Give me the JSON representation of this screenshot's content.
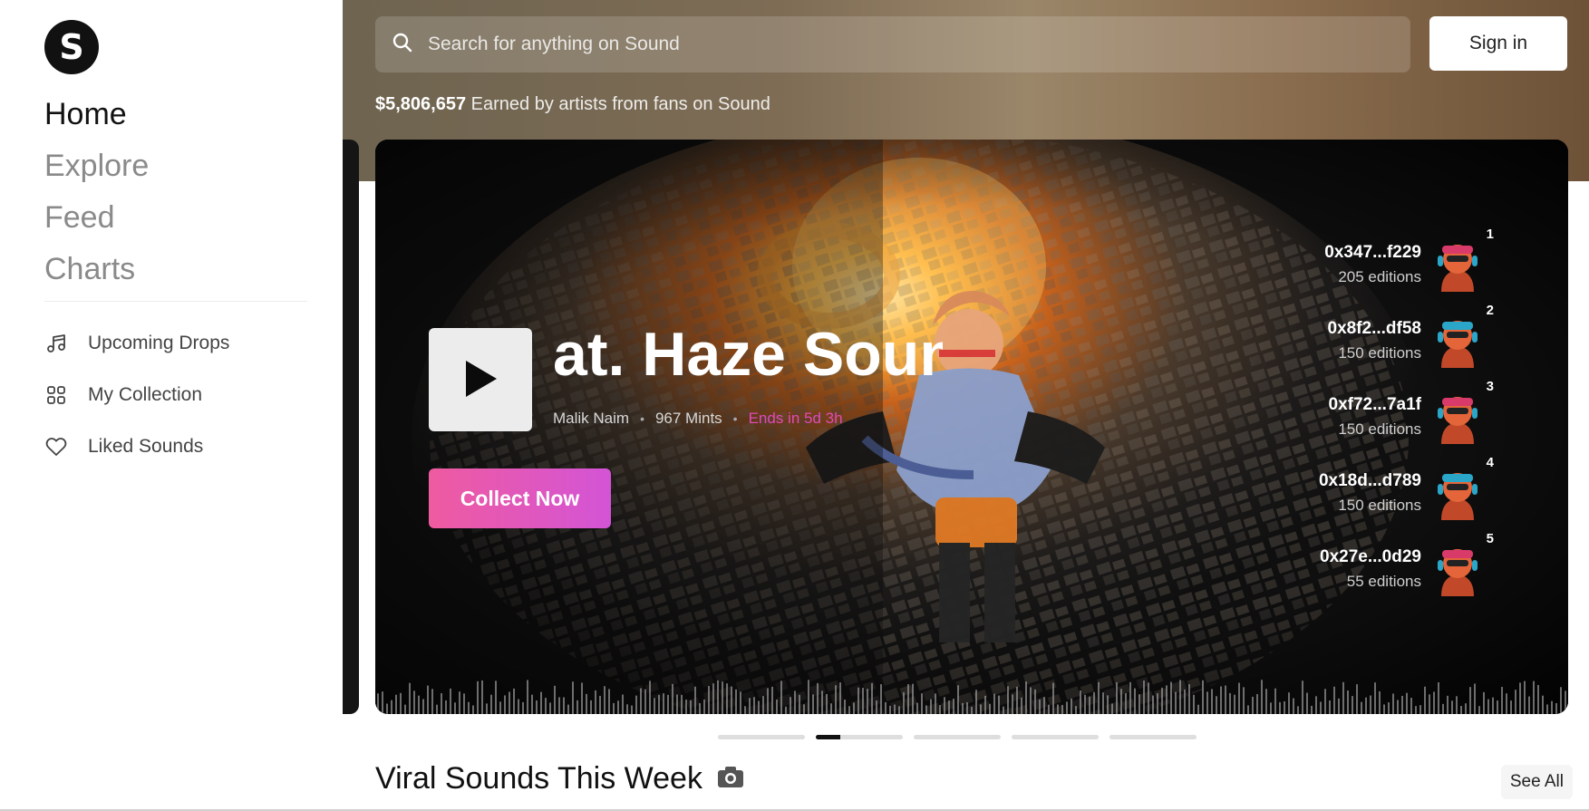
{
  "sidebar": {
    "logo_letter": "S",
    "nav": [
      {
        "label": "Home"
      },
      {
        "label": "Explore"
      },
      {
        "label": "Feed"
      },
      {
        "label": "Charts"
      }
    ],
    "sub_nav": [
      {
        "label": "Upcoming Drops",
        "icon": "music-note-icon"
      },
      {
        "label": "My Collection",
        "icon": "grid-icon"
      },
      {
        "label": "Liked Sounds",
        "icon": "heart-icon"
      }
    ]
  },
  "header": {
    "search_placeholder": "Search for anything on Sound",
    "signin_label": "Sign in",
    "earned_amount": "$5,806,657",
    "earned_text": "Earned by artists from fans on Sound"
  },
  "hero": {
    "title": "at. Haze  Sound",
    "artist": "Malik Naim",
    "mints": "967 Mints",
    "ends": "Ends in 5d 3h",
    "collect_label": "Collect Now",
    "collectors": [
      {
        "rank": "1",
        "address": "0x347...f229",
        "editions": "205 editions"
      },
      {
        "rank": "2",
        "address": "0x8f2...df58",
        "editions": "150 editions"
      },
      {
        "rank": "3",
        "address": "0xf72...7a1f",
        "editions": "150 editions"
      },
      {
        "rank": "4",
        "address": "0x18d...d789",
        "editions": "150 editions"
      },
      {
        "rank": "5",
        "address": "0x27e...0d29",
        "editions": "55 editions"
      }
    ]
  },
  "pager": {
    "count": 5,
    "active_index": 1,
    "active_progress": 0.28
  },
  "section": {
    "title": "Viral Sounds This Week",
    "see_all_label": "See All"
  },
  "colors": {
    "accent_pink": "#ef5ba0",
    "accent_purple": "#d354d6",
    "ends_text": "#e04ab8"
  }
}
